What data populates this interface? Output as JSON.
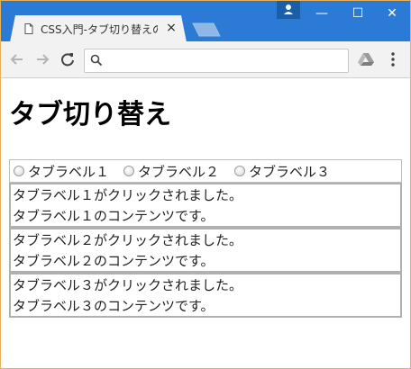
{
  "browser": {
    "tab_title": "CSS入門-タブ切り替えの実",
    "tab_close": "×",
    "minimize": "—",
    "maximize": "☐",
    "close": "✕",
    "address_value": ""
  },
  "page": {
    "heading": "タブ切り替え",
    "tabs": [
      {
        "label": "タブラベル１"
      },
      {
        "label": "タブラベル２"
      },
      {
        "label": "タブラベル３"
      }
    ],
    "panels": [
      {
        "line1": "タブラベル１がクリックされました。",
        "line2": "タブラベル１のコンテンツです。"
      },
      {
        "line1": "タブラベル２がクリックされました。",
        "line2": "タブラベル２のコンテンツです。"
      },
      {
        "line1": "タブラベル３がクリックされました。",
        "line2": "タブラベル３のコンテンツです。"
      }
    ]
  },
  "colors": {
    "titlebar": "#2b7bd6",
    "toolbar": "#f2f2f2",
    "frame": "#e6b25c"
  }
}
